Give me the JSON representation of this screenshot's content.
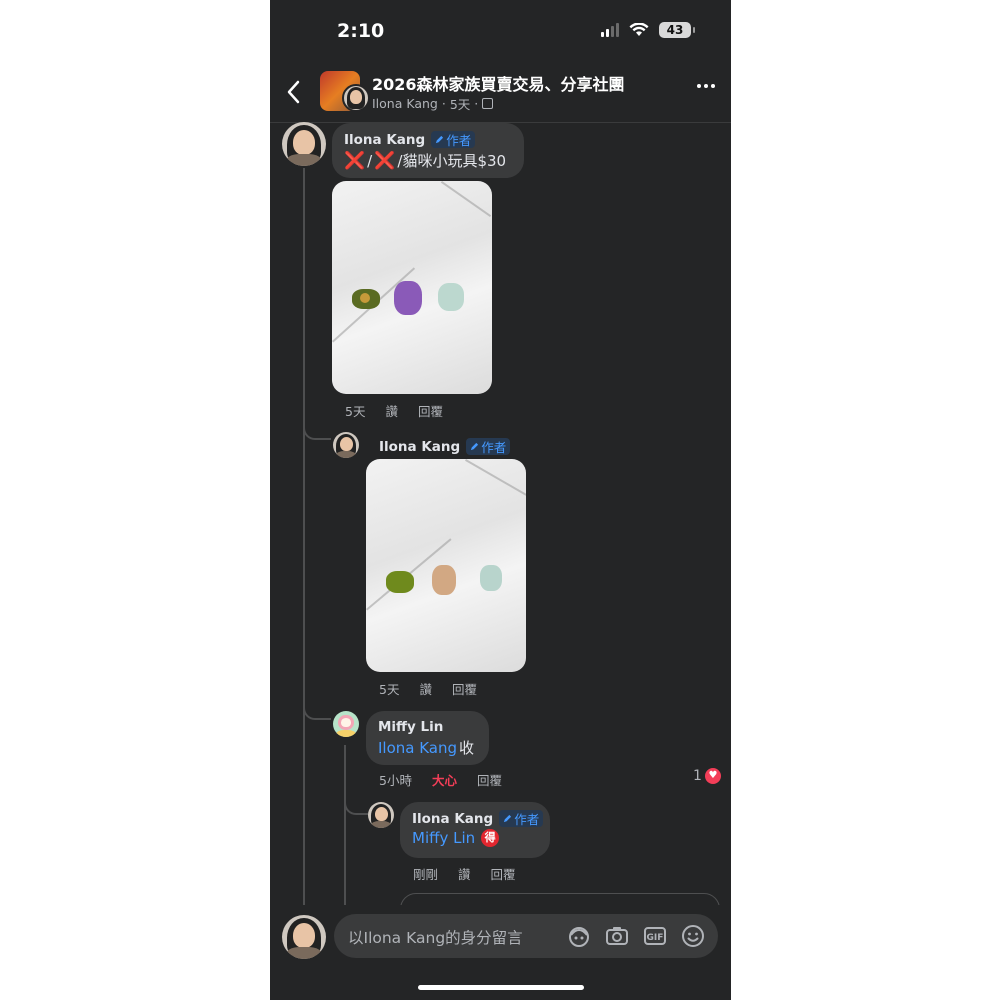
{
  "status": {
    "time": "2:10",
    "battery": "43"
  },
  "header": {
    "group_title": "2026森林家族買賣交易、分享社團",
    "author": "Ilona Kang",
    "age": "5天"
  },
  "comments": [
    {
      "name": "Ilona Kang",
      "badge": "作者",
      "text_suffix": "/貓咪小玩具$30",
      "x1": "❌",
      "slash": "/",
      "x2": "❌",
      "actions": {
        "time": "5天",
        "like": "讚",
        "reply": "回覆"
      }
    },
    {
      "name": "Ilona Kang",
      "badge": "作者",
      "actions": {
        "time": "5天",
        "like": "讚",
        "reply": "回覆"
      }
    },
    {
      "name": "Miffy Lin",
      "mention": "Ilona Kang",
      "text": " 收",
      "actions": {
        "time": "5小時",
        "like": "大心",
        "reply": "回覆"
      },
      "reaction_count": "1"
    },
    {
      "name": "Ilona Kang",
      "badge": "作者",
      "mention": "Miffy Lin",
      "emoji": "得",
      "actions": {
        "time": "剛剛",
        "like": "讚",
        "reply": "回覆"
      }
    }
  ],
  "composer": {
    "placeholder": "以Ilona Kang的身分留言"
  },
  "icons": [
    "back-chevron-icon",
    "more-icon",
    "avatar-sticker-icon",
    "camera-icon",
    "gif-icon",
    "emoji-icon",
    "heart-reaction-icon",
    "pencil-icon"
  ],
  "colors": {
    "background": "#242526",
    "bubble": "#3a3b3c",
    "accent": "#4599ff",
    "love": "#f33e58"
  }
}
